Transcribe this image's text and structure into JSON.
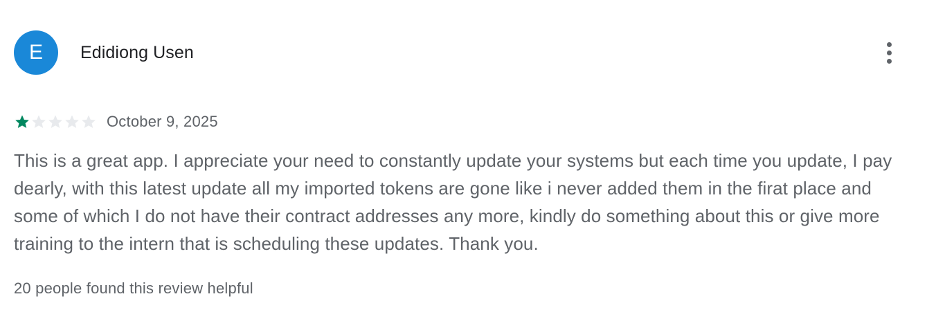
{
  "review": {
    "avatar_initial": "E",
    "reviewer_name": "Edidiong Usen",
    "more_options_icon": "more-vertical-icon",
    "rating": 1,
    "rating_max": 5,
    "date": "October 9, 2025",
    "text": "This is a great app. I appreciate your need to constantly update your systems but each time you update, I pay dearly, with this latest update all my imported tokens are gone like i never added them in the firat place and some of which I do not have their contract addresses any more, kindly do something about this or give more training to the intern that is scheduling these updates. Thank you.",
    "helpful_text": "20 people found this review helpful"
  },
  "colors": {
    "avatar_bg": "#1a88d8",
    "star_filled": "#01875f",
    "star_empty": "#e8eaed",
    "text_primary": "#202124",
    "text_secondary": "#5f6368"
  }
}
